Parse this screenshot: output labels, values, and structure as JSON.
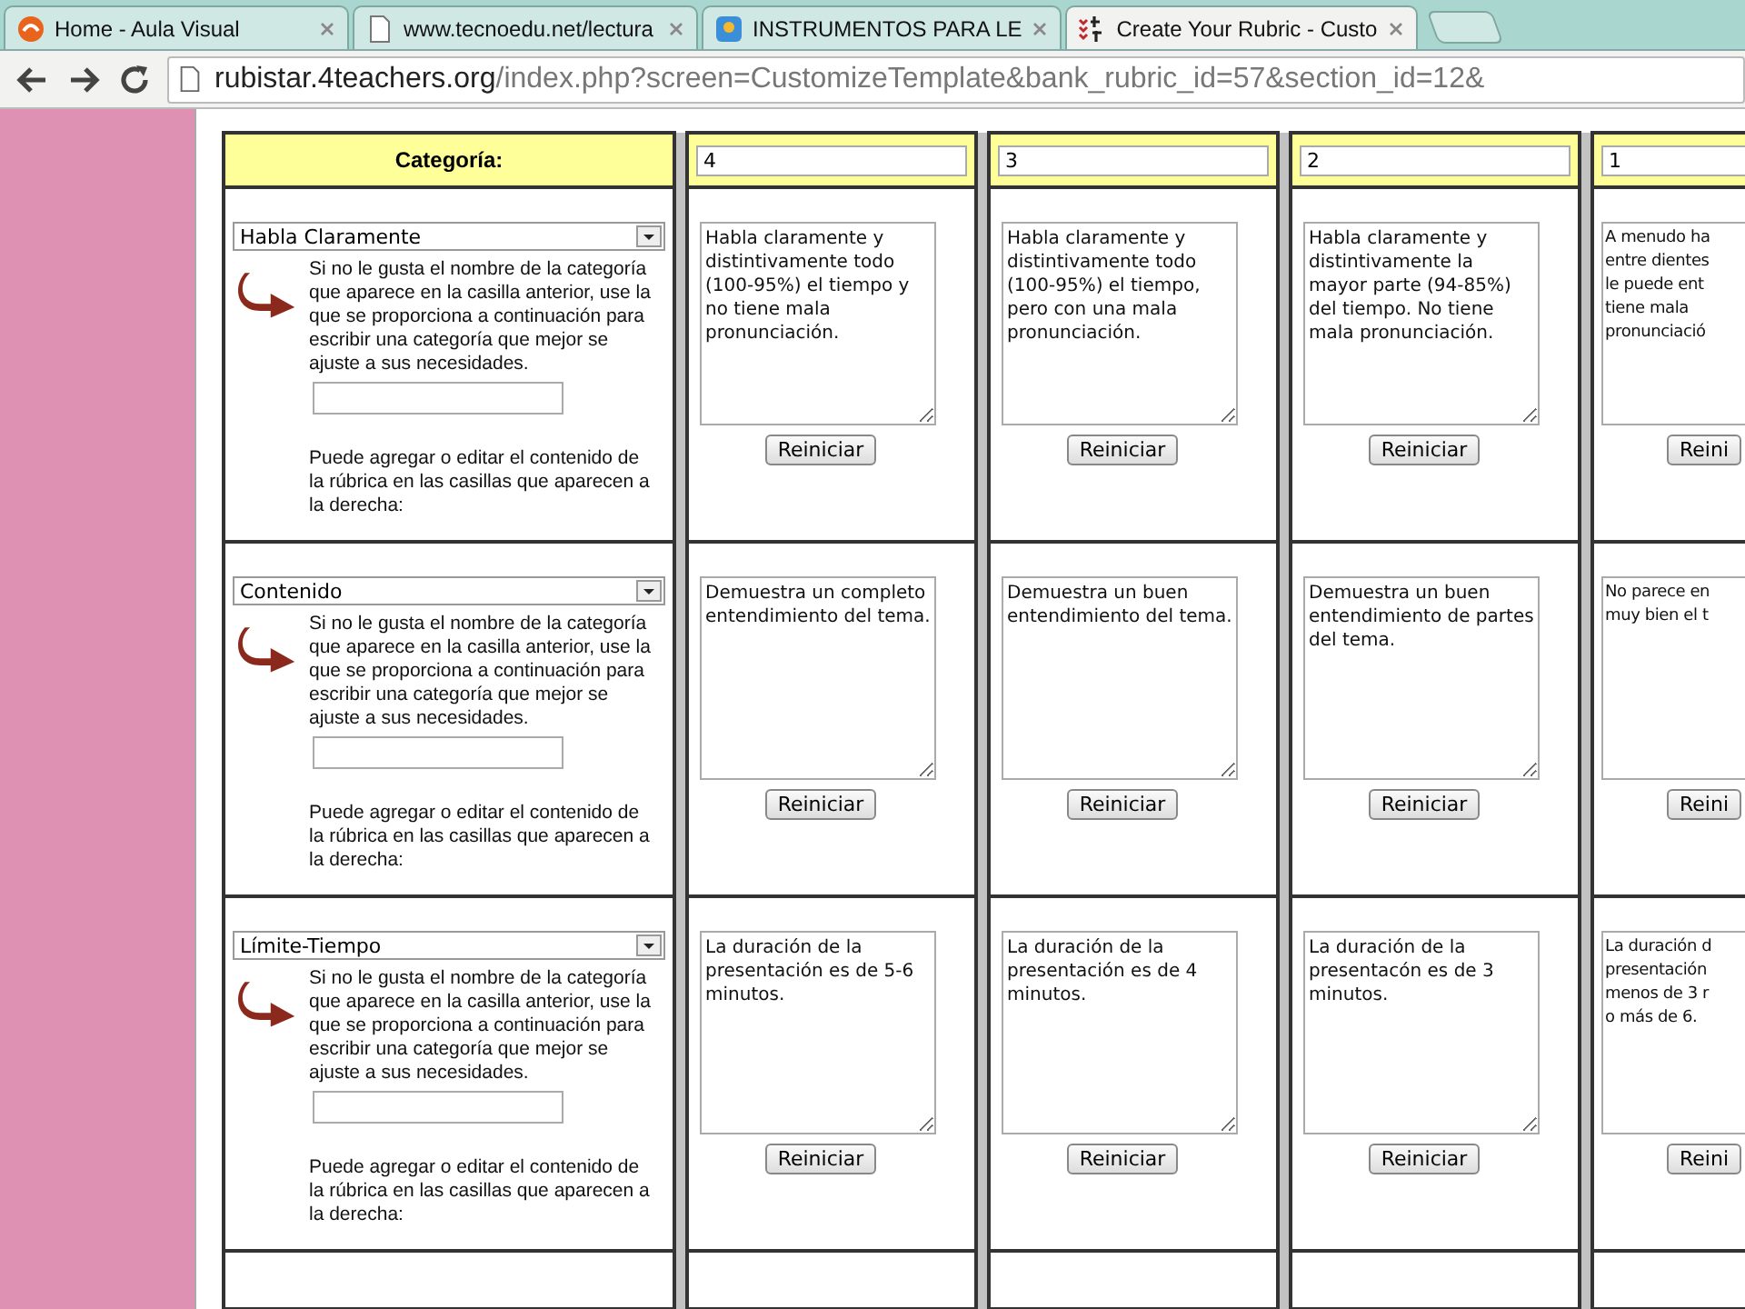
{
  "browser": {
    "tabs": [
      {
        "title": "Home - Aula Visual",
        "kind": "logo",
        "selected": false
      },
      {
        "title": "www.tecnoedu.net/lectura",
        "kind": "page",
        "selected": false
      },
      {
        "title": "INSTRUMENTOS PARA LE",
        "kind": "app",
        "selected": false
      },
      {
        "title": "Create Your Rubric - Custo",
        "kind": "rubric",
        "selected": true
      }
    ],
    "address": {
      "domain": "rubistar.4teachers.org",
      "path": "/index.php?screen=CustomizeTemplate&bank_rubric_id=57&section_id=12&"
    }
  },
  "rubric": {
    "header": {
      "category_label": "Categoría:",
      "levels": [
        "4",
        "3",
        "2",
        "1"
      ]
    },
    "rows": [
      {
        "category": "Habla Claramente",
        "hint": "Si no le gusta el nombre de la categoría que aparece en la casilla anterior, use la que se proporciona a continuación para escribir una categoría que mejor se ajuste a sus necesidades.",
        "note": "Puede agregar o editar el contenido de la rúbrica en las casillas que aparecen a la derecha:",
        "cells": [
          {
            "text": "Habla claramente y distintivamente todo (100-95%) el tiempo y no tiene mala pronunciación.",
            "button": "Reiniciar"
          },
          {
            "text": "Habla claramente y distintivamente todo (100-95%) el tiempo, pero con una mala pronunciación.",
            "button": "Reiniciar"
          },
          {
            "text": "Habla claramente y distintivamente la mayor parte (94-85%) del tiempo. No tiene mala pronunciación.",
            "button": "Reiniciar"
          },
          {
            "text": "A menudo ha\nentre dientes\nle puede ent\ntiene mala\npronunciació",
            "button": "Reini"
          }
        ]
      },
      {
        "category": "Contenido",
        "hint": "Si no le gusta el nombre de la categoría que aparece en la casilla anterior, use la que se proporciona a continuación para escribir una categoría que mejor se ajuste a sus necesidades.",
        "note": "Puede agregar o editar el contenido de la rúbrica en las casillas que aparecen a la derecha:",
        "cells": [
          {
            "text": "Demuestra un completo entendimiento del tema.",
            "button": "Reiniciar"
          },
          {
            "text": "Demuestra un buen entendimiento del tema.",
            "button": "Reiniciar"
          },
          {
            "text": "Demuestra un buen entendimiento de partes del tema.",
            "button": "Reiniciar"
          },
          {
            "text": "No parece en\nmuy bien el t",
            "button": "Reini"
          }
        ]
      },
      {
        "category": "Límite-Tiempo",
        "hint": "Si no le gusta el nombre de la categoría que aparece en la casilla anterior, use la que se proporciona a continuación para escribir una categoría que mejor se ajuste a sus necesidades.",
        "note": "Puede agregar o editar el contenido de la rúbrica en las casillas que aparecen a la derecha:",
        "cells": [
          {
            "text": "La duración de la presentación es de 5-6 minutos.",
            "button": "Reiniciar"
          },
          {
            "text": "La duración de la presentación es de 4 minutos.",
            "button": "Reiniciar"
          },
          {
            "text": "La duración de la presentacón es de 3 minutos.",
            "button": "Reiniciar"
          },
          {
            "text": "La duración d\npresentación\nmenos de 3 r\no más de 6.",
            "button": "Reini"
          }
        ]
      }
    ]
  }
}
